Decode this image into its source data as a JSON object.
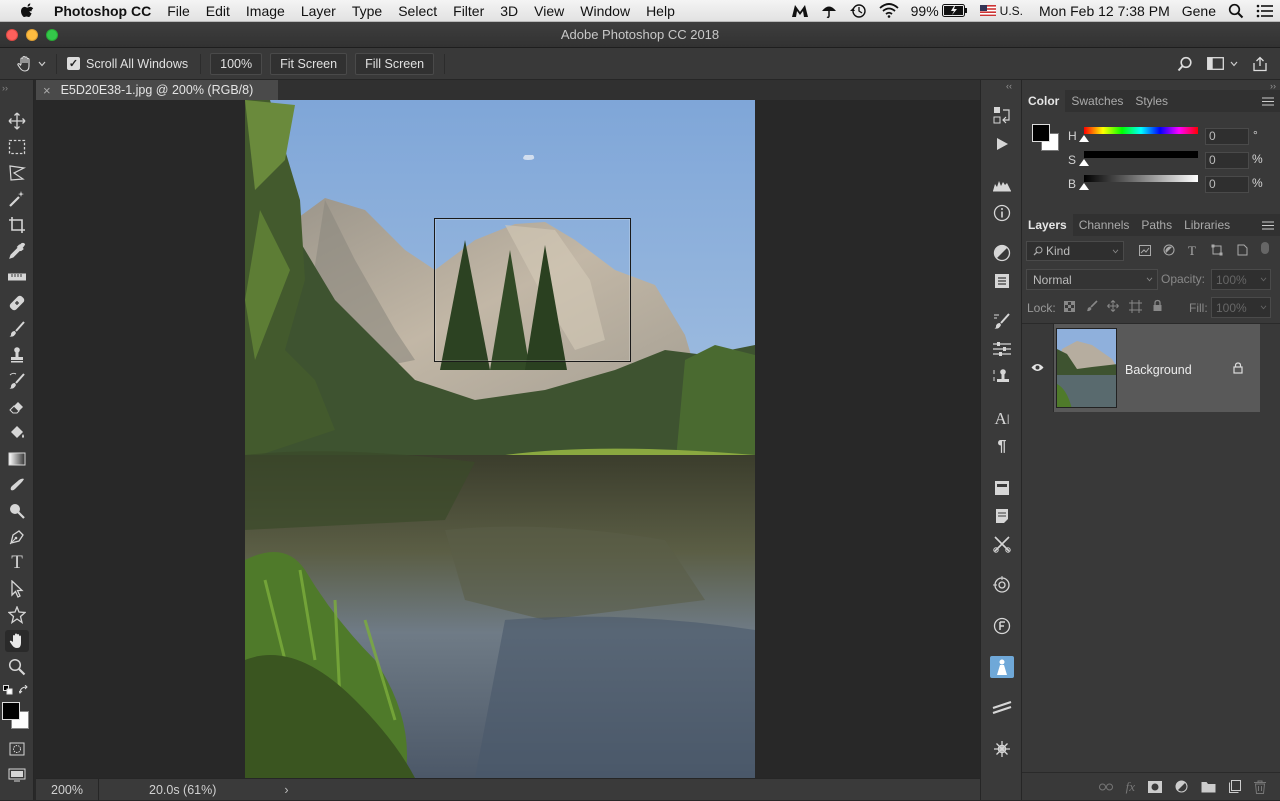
{
  "menubar": {
    "app_name": "Photoshop CC",
    "items": [
      "File",
      "Edit",
      "Image",
      "Layer",
      "Type",
      "Select",
      "Filter",
      "3D",
      "View",
      "Window",
      "Help"
    ],
    "battery": "99%",
    "input_source": "U.S.",
    "datetime": "Mon Feb 12  7:38 PM",
    "user": "Gene"
  },
  "window": {
    "title": "Adobe Photoshop CC 2018"
  },
  "options_bar": {
    "scroll_all_label": "Scroll All Windows",
    "scroll_all_checked": true,
    "zoom_button": "100%",
    "fit_screen": "Fit Screen",
    "fill_screen": "Fill Screen"
  },
  "document": {
    "tab_title": "E5D20E38-1.jpg @ 200% (RGB/8)",
    "zoom": "200%",
    "status": "20.0s (61%)"
  },
  "color_panel": {
    "tabs": [
      "Color",
      "Swatches",
      "Styles"
    ],
    "active_tab": "Color",
    "rows": [
      {
        "label": "H",
        "value": "0",
        "unit": "°"
      },
      {
        "label": "S",
        "value": "0",
        "unit": "%"
      },
      {
        "label": "B",
        "value": "0",
        "unit": "%"
      }
    ]
  },
  "layers_panel": {
    "tabs": [
      "Layers",
      "Channels",
      "Paths",
      "Libraries"
    ],
    "active_tab": "Layers",
    "filter_placeholder": "Kind",
    "blend_mode": "Normal",
    "opacity_label": "Opacity:",
    "opacity_value": "100%",
    "lock_label": "Lock:",
    "fill_label": "Fill:",
    "fill_value": "100%",
    "layers": [
      {
        "name": "Background",
        "visible": true,
        "locked": true
      }
    ]
  },
  "colors": {
    "accent": "#3b3b3b",
    "foreground": "#000000",
    "background": "#ffffff"
  }
}
